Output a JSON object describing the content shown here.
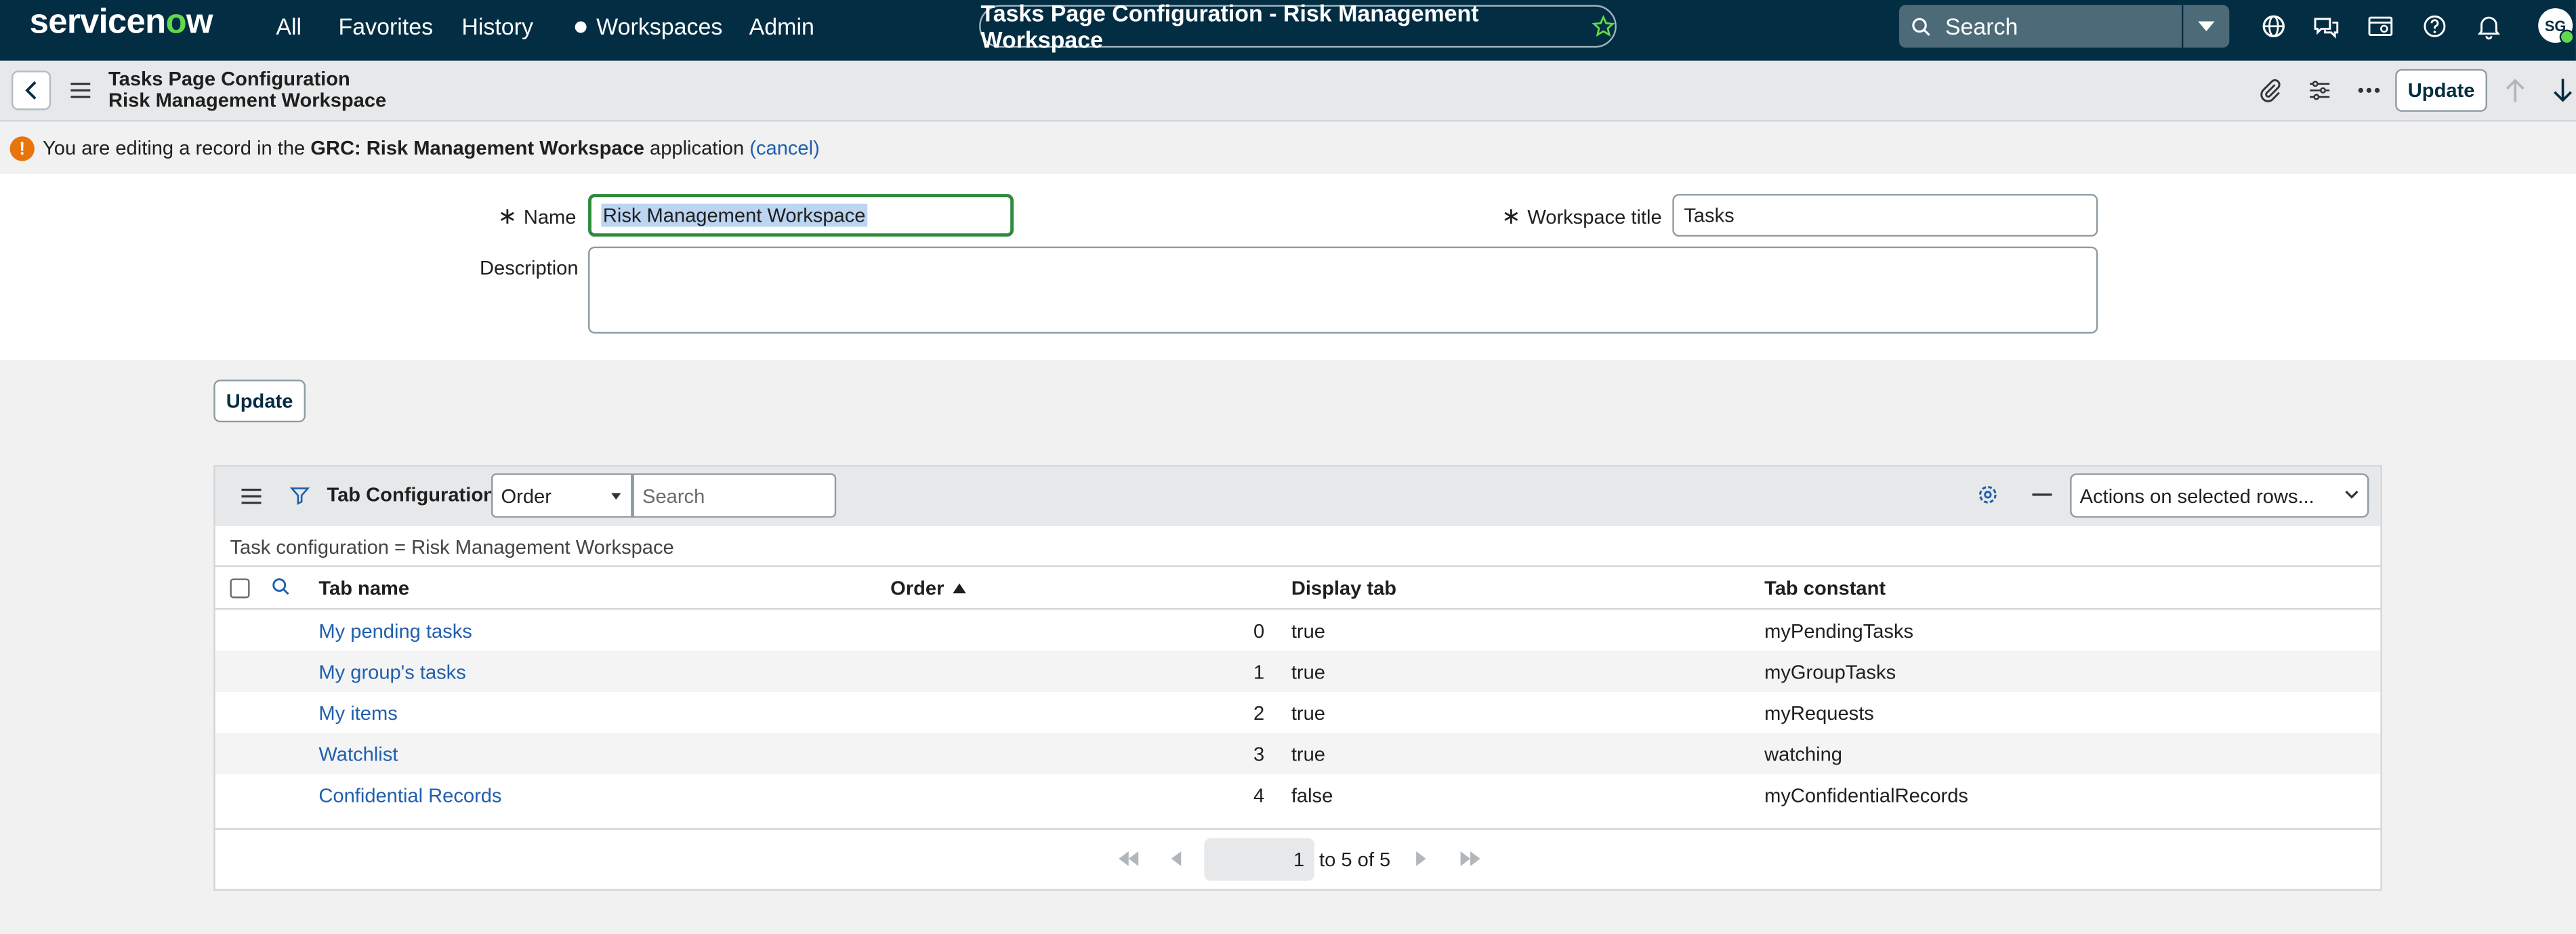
{
  "nav": {
    "logo_prefix": "servicen",
    "logo_o": "o",
    "logo_suffix": "w",
    "items": [
      "All",
      "Favorites",
      "History",
      "Workspaces",
      "Admin"
    ],
    "title": "Tasks Page Configuration - Risk Management Workspace",
    "search_placeholder": "Search",
    "avatar_initials": "SG",
    "icons": [
      "globe-icon",
      "chat-icon",
      "inbox-icon",
      "help-icon",
      "bell-icon"
    ]
  },
  "header": {
    "title_line1": "Tasks Page Configuration",
    "title_line2": "Risk Management Workspace",
    "update_label": "Update"
  },
  "notice": {
    "prefix": "You are editing a record in the",
    "app": "GRC: Risk Management Workspace",
    "suffix": "application",
    "cancel": "(cancel)"
  },
  "form": {
    "name_label": "Name",
    "name_value": "Risk Management Workspace",
    "workspace_title_label": "Workspace title",
    "workspace_title_value": "Tasks",
    "description_label": "Description",
    "description_value": "",
    "required_mark": "∗",
    "update_label": "Update"
  },
  "related_list": {
    "title": "Tab Configurations",
    "order_select": "Order",
    "search_placeholder": "Search",
    "actions": "Actions on selected rows...",
    "condition": "Task configuration = Risk Management Workspace",
    "columns": [
      "Tab name",
      "Order",
      "Display tab",
      "Tab constant"
    ],
    "rows": [
      {
        "name": "My pending tasks",
        "order": "0",
        "display": "true",
        "constant": "myPendingTasks"
      },
      {
        "name": "My group's tasks",
        "order": "1",
        "display": "true",
        "constant": "myGroupTasks"
      },
      {
        "name": "My items",
        "order": "2",
        "display": "true",
        "constant": "myRequests"
      },
      {
        "name": "Watchlist",
        "order": "3",
        "display": "true",
        "constant": "watching"
      },
      {
        "name": "Confidential Records",
        "order": "4",
        "display": "false",
        "constant": "myConfidentialRecords"
      }
    ],
    "pager": {
      "page": "1",
      "range": "to 5 of 5"
    }
  },
  "colors": {
    "nav_bg": "#032d42",
    "brand_green": "#62d84e",
    "link": "#1f5fad",
    "warning": "#e8740c"
  }
}
